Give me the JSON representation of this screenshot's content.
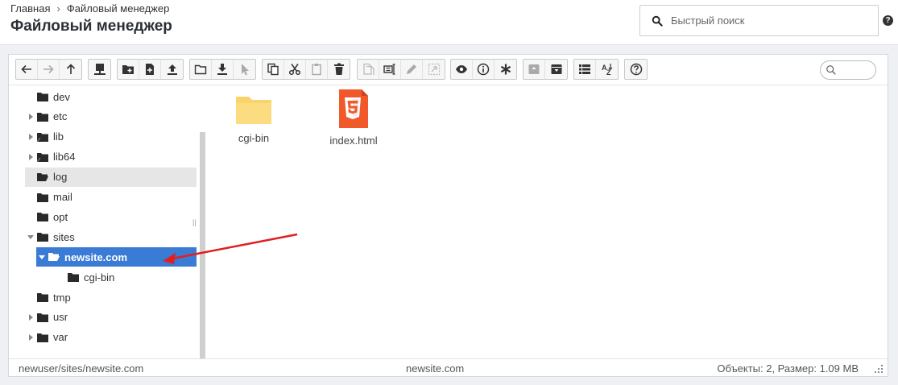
{
  "header": {
    "breadcrumb": {
      "home": "Главная",
      "separator": "›",
      "current": "Файловый менеджер"
    },
    "title": "Файловый менеджер",
    "search_placeholder": "Быстрый поиск",
    "help_mark": "?"
  },
  "toolbar": {
    "groups": [
      [
        "back-icon",
        "forward-icon",
        "up-icon"
      ],
      [
        "network-drive-icon"
      ],
      [
        "new-folder-icon",
        "new-file-icon",
        "upload-icon"
      ],
      [
        "open-icon",
        "download-icon",
        "select-icon"
      ],
      [
        "copy-icon",
        "cut-icon",
        "paste-icon",
        "delete-icon"
      ],
      [
        "duplicate-icon",
        "rename-icon",
        "edit-icon",
        "resize-icon"
      ],
      [
        "view-icon",
        "info-icon",
        "asterisk-icon"
      ],
      [
        "archive-icon",
        "extract-icon"
      ],
      [
        "list-view-icon",
        "sort-icon"
      ],
      [
        "help-icon"
      ]
    ]
  },
  "tree": {
    "items": [
      {
        "label": "dev",
        "has_children": false,
        "state": "normal"
      },
      {
        "label": "etc",
        "has_children": true,
        "state": "normal"
      },
      {
        "label": "lib",
        "has_children": true,
        "state": "normal",
        "symlink": true
      },
      {
        "label": "lib64",
        "has_children": true,
        "state": "normal",
        "symlink": true
      },
      {
        "label": "log",
        "has_children": false,
        "state": "hover",
        "open": true
      },
      {
        "label": "mail",
        "has_children": false,
        "state": "normal"
      },
      {
        "label": "opt",
        "has_children": false,
        "state": "normal"
      },
      {
        "label": "sites",
        "has_children": true,
        "state": "expanded"
      },
      {
        "label": "newsite.com",
        "has_children": true,
        "state": "selected"
      },
      {
        "label": "cgi-bin",
        "has_children": false,
        "state": "normal"
      },
      {
        "label": "tmp",
        "has_children": false,
        "state": "normal"
      },
      {
        "label": "usr",
        "has_children": true,
        "state": "normal"
      },
      {
        "label": "var",
        "has_children": true,
        "state": "normal"
      }
    ]
  },
  "files": [
    {
      "name": "cgi-bin",
      "type": "folder"
    },
    {
      "name": "index.html",
      "type": "html"
    }
  ],
  "status": {
    "path": "newuser/sites/newsite.com",
    "current": "newsite.com",
    "summary": "Объекты: 2, Размер: 1.09 MB"
  },
  "colors": {
    "accent": "#3a7bd5",
    "folder": "#f9d46d",
    "html_icon": "#f1592a",
    "annotation_arrow": "#e02020"
  }
}
